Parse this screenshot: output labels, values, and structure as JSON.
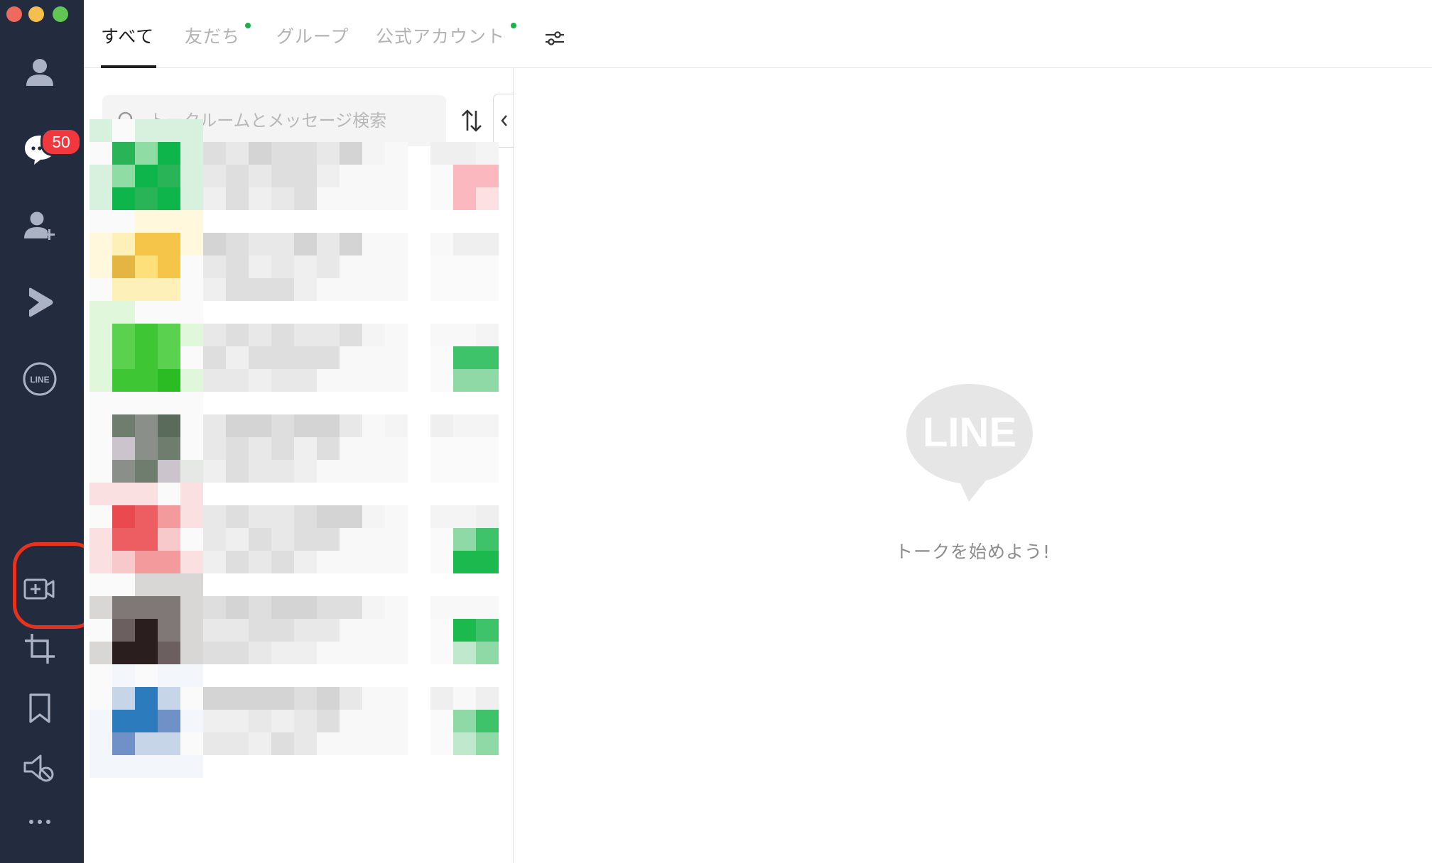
{
  "window": {
    "controls": [
      "close",
      "minimize",
      "maximize"
    ]
  },
  "sidebar": {
    "items": [
      {
        "name": "friends",
        "icon": "person-icon"
      },
      {
        "name": "chats",
        "icon": "chat-bubble-icon",
        "badge": "50"
      },
      {
        "name": "add-friends",
        "icon": "add-person-icon"
      },
      {
        "name": "line-voom",
        "icon": "voom-play-icon"
      },
      {
        "name": "line-services",
        "icon": "line-logo-icon",
        "label": "LINE"
      },
      {
        "name": "meeting",
        "icon": "video-plus-icon"
      },
      {
        "name": "screenshot",
        "icon": "crop-icon"
      },
      {
        "name": "keep",
        "icon": "bookmark-icon"
      },
      {
        "name": "notifications-muted",
        "icon": "mute-icon"
      },
      {
        "name": "more",
        "icon": "more-icon"
      }
    ],
    "highlight_color": "#e8321e"
  },
  "tabs": {
    "all": "すべて",
    "friends": "友だち",
    "groups": "グループ",
    "official": "公式アカウント"
  },
  "search": {
    "placeholder": "トークルームとメッセージ検索"
  },
  "empty_state": {
    "logo_text": "LINE",
    "message": "トークを始めよう!"
  },
  "colors": {
    "sidebar_bg": "#232c3f",
    "badge": "#f0383e",
    "accent_green": "#17b34a"
  }
}
